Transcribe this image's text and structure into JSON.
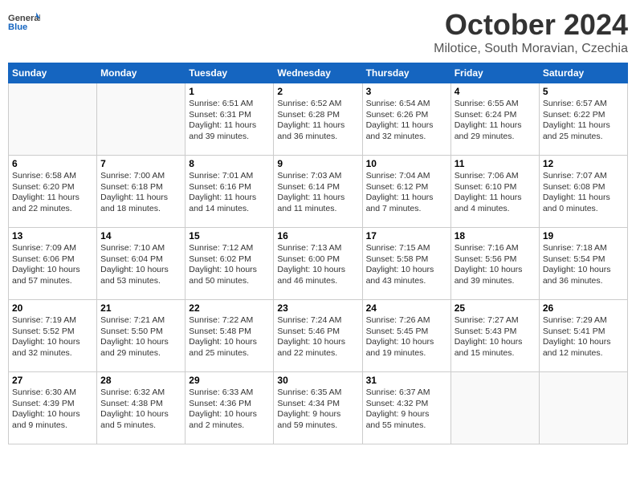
{
  "header": {
    "logo_general": "General",
    "logo_blue": "Blue",
    "month_title": "October 2024",
    "subtitle": "Milotice, South Moravian, Czechia"
  },
  "days_of_week": [
    "Sunday",
    "Monday",
    "Tuesday",
    "Wednesday",
    "Thursday",
    "Friday",
    "Saturday"
  ],
  "weeks": [
    [
      {
        "day": "",
        "info": ""
      },
      {
        "day": "",
        "info": ""
      },
      {
        "day": "1",
        "info": "Sunrise: 6:51 AM\nSunset: 6:31 PM\nDaylight: 11 hours\nand 39 minutes."
      },
      {
        "day": "2",
        "info": "Sunrise: 6:52 AM\nSunset: 6:28 PM\nDaylight: 11 hours\nand 36 minutes."
      },
      {
        "day": "3",
        "info": "Sunrise: 6:54 AM\nSunset: 6:26 PM\nDaylight: 11 hours\nand 32 minutes."
      },
      {
        "day": "4",
        "info": "Sunrise: 6:55 AM\nSunset: 6:24 PM\nDaylight: 11 hours\nand 29 minutes."
      },
      {
        "day": "5",
        "info": "Sunrise: 6:57 AM\nSunset: 6:22 PM\nDaylight: 11 hours\nand 25 minutes."
      }
    ],
    [
      {
        "day": "6",
        "info": "Sunrise: 6:58 AM\nSunset: 6:20 PM\nDaylight: 11 hours\nand 22 minutes."
      },
      {
        "day": "7",
        "info": "Sunrise: 7:00 AM\nSunset: 6:18 PM\nDaylight: 11 hours\nand 18 minutes."
      },
      {
        "day": "8",
        "info": "Sunrise: 7:01 AM\nSunset: 6:16 PM\nDaylight: 11 hours\nand 14 minutes."
      },
      {
        "day": "9",
        "info": "Sunrise: 7:03 AM\nSunset: 6:14 PM\nDaylight: 11 hours\nand 11 minutes."
      },
      {
        "day": "10",
        "info": "Sunrise: 7:04 AM\nSunset: 6:12 PM\nDaylight: 11 hours\nand 7 minutes."
      },
      {
        "day": "11",
        "info": "Sunrise: 7:06 AM\nSunset: 6:10 PM\nDaylight: 11 hours\nand 4 minutes."
      },
      {
        "day": "12",
        "info": "Sunrise: 7:07 AM\nSunset: 6:08 PM\nDaylight: 11 hours\nand 0 minutes."
      }
    ],
    [
      {
        "day": "13",
        "info": "Sunrise: 7:09 AM\nSunset: 6:06 PM\nDaylight: 10 hours\nand 57 minutes."
      },
      {
        "day": "14",
        "info": "Sunrise: 7:10 AM\nSunset: 6:04 PM\nDaylight: 10 hours\nand 53 minutes."
      },
      {
        "day": "15",
        "info": "Sunrise: 7:12 AM\nSunset: 6:02 PM\nDaylight: 10 hours\nand 50 minutes."
      },
      {
        "day": "16",
        "info": "Sunrise: 7:13 AM\nSunset: 6:00 PM\nDaylight: 10 hours\nand 46 minutes."
      },
      {
        "day": "17",
        "info": "Sunrise: 7:15 AM\nSunset: 5:58 PM\nDaylight: 10 hours\nand 43 minutes."
      },
      {
        "day": "18",
        "info": "Sunrise: 7:16 AM\nSunset: 5:56 PM\nDaylight: 10 hours\nand 39 minutes."
      },
      {
        "day": "19",
        "info": "Sunrise: 7:18 AM\nSunset: 5:54 PM\nDaylight: 10 hours\nand 36 minutes."
      }
    ],
    [
      {
        "day": "20",
        "info": "Sunrise: 7:19 AM\nSunset: 5:52 PM\nDaylight: 10 hours\nand 32 minutes."
      },
      {
        "day": "21",
        "info": "Sunrise: 7:21 AM\nSunset: 5:50 PM\nDaylight: 10 hours\nand 29 minutes."
      },
      {
        "day": "22",
        "info": "Sunrise: 7:22 AM\nSunset: 5:48 PM\nDaylight: 10 hours\nand 25 minutes."
      },
      {
        "day": "23",
        "info": "Sunrise: 7:24 AM\nSunset: 5:46 PM\nDaylight: 10 hours\nand 22 minutes."
      },
      {
        "day": "24",
        "info": "Sunrise: 7:26 AM\nSunset: 5:45 PM\nDaylight: 10 hours\nand 19 minutes."
      },
      {
        "day": "25",
        "info": "Sunrise: 7:27 AM\nSunset: 5:43 PM\nDaylight: 10 hours\nand 15 minutes."
      },
      {
        "day": "26",
        "info": "Sunrise: 7:29 AM\nSunset: 5:41 PM\nDaylight: 10 hours\nand 12 minutes."
      }
    ],
    [
      {
        "day": "27",
        "info": "Sunrise: 6:30 AM\nSunset: 4:39 PM\nDaylight: 10 hours\nand 9 minutes."
      },
      {
        "day": "28",
        "info": "Sunrise: 6:32 AM\nSunset: 4:38 PM\nDaylight: 10 hours\nand 5 minutes."
      },
      {
        "day": "29",
        "info": "Sunrise: 6:33 AM\nSunset: 4:36 PM\nDaylight: 10 hours\nand 2 minutes."
      },
      {
        "day": "30",
        "info": "Sunrise: 6:35 AM\nSunset: 4:34 PM\nDaylight: 9 hours\nand 59 minutes."
      },
      {
        "day": "31",
        "info": "Sunrise: 6:37 AM\nSunset: 4:32 PM\nDaylight: 9 hours\nand 55 minutes."
      },
      {
        "day": "",
        "info": ""
      },
      {
        "day": "",
        "info": ""
      }
    ]
  ]
}
